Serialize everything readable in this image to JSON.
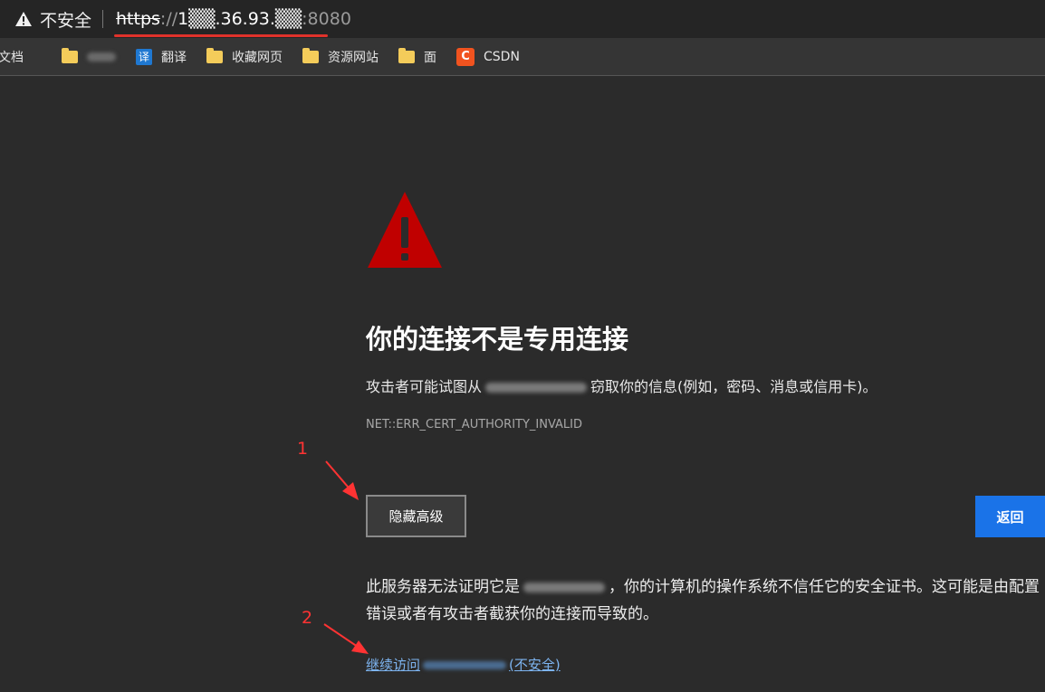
{
  "addressbar": {
    "insecure_label": "不安全",
    "url_scheme": "https",
    "url_slashes": "://",
    "url_host": "1▒▒.36.93.▒▒",
    "url_port": ":8080",
    "underline_color": "#e0322b"
  },
  "bookmarks": [
    {
      "label": "文档",
      "icon": "none"
    },
    {
      "label": "",
      "icon": "folder-icon"
    },
    {
      "label": "翻译",
      "icon": "translate-icon",
      "glyph": "译"
    },
    {
      "label": "收藏网页",
      "icon": "folder-icon"
    },
    {
      "label": "资源网站",
      "icon": "folder-icon"
    },
    {
      "label": "面",
      "icon": "folder-icon"
    },
    {
      "label": "CSDN",
      "icon": "csdn-icon",
      "glyph": "C"
    }
  ],
  "error_page": {
    "icon": "warning-triangle-icon",
    "icon_color": "#c00000",
    "title": "你的连接不是专用连接",
    "desc_prefix": "攻击者可能试图从",
    "desc_suffix": "窃取你的信息(例如，密码、消息或信用卡)。",
    "error_code": "NET::ERR_CERT_AUTHORITY_INVALID",
    "hide_advanced_label": "隐藏高级",
    "back_label": "返回",
    "back_color": "#1a73e8",
    "explain_prefix": "此服务器无法证明它是",
    "explain_suffix": "，你的计算机的操作系统不信任它的安全证书。这可能是由配置错误或者有攻击者截获你的连接而导致的。",
    "proceed_prefix": "继续访问",
    "proceed_suffix": "(不安全)"
  },
  "annotations": {
    "num_1": "1",
    "num_2": "2",
    "color": "#ff3333"
  }
}
